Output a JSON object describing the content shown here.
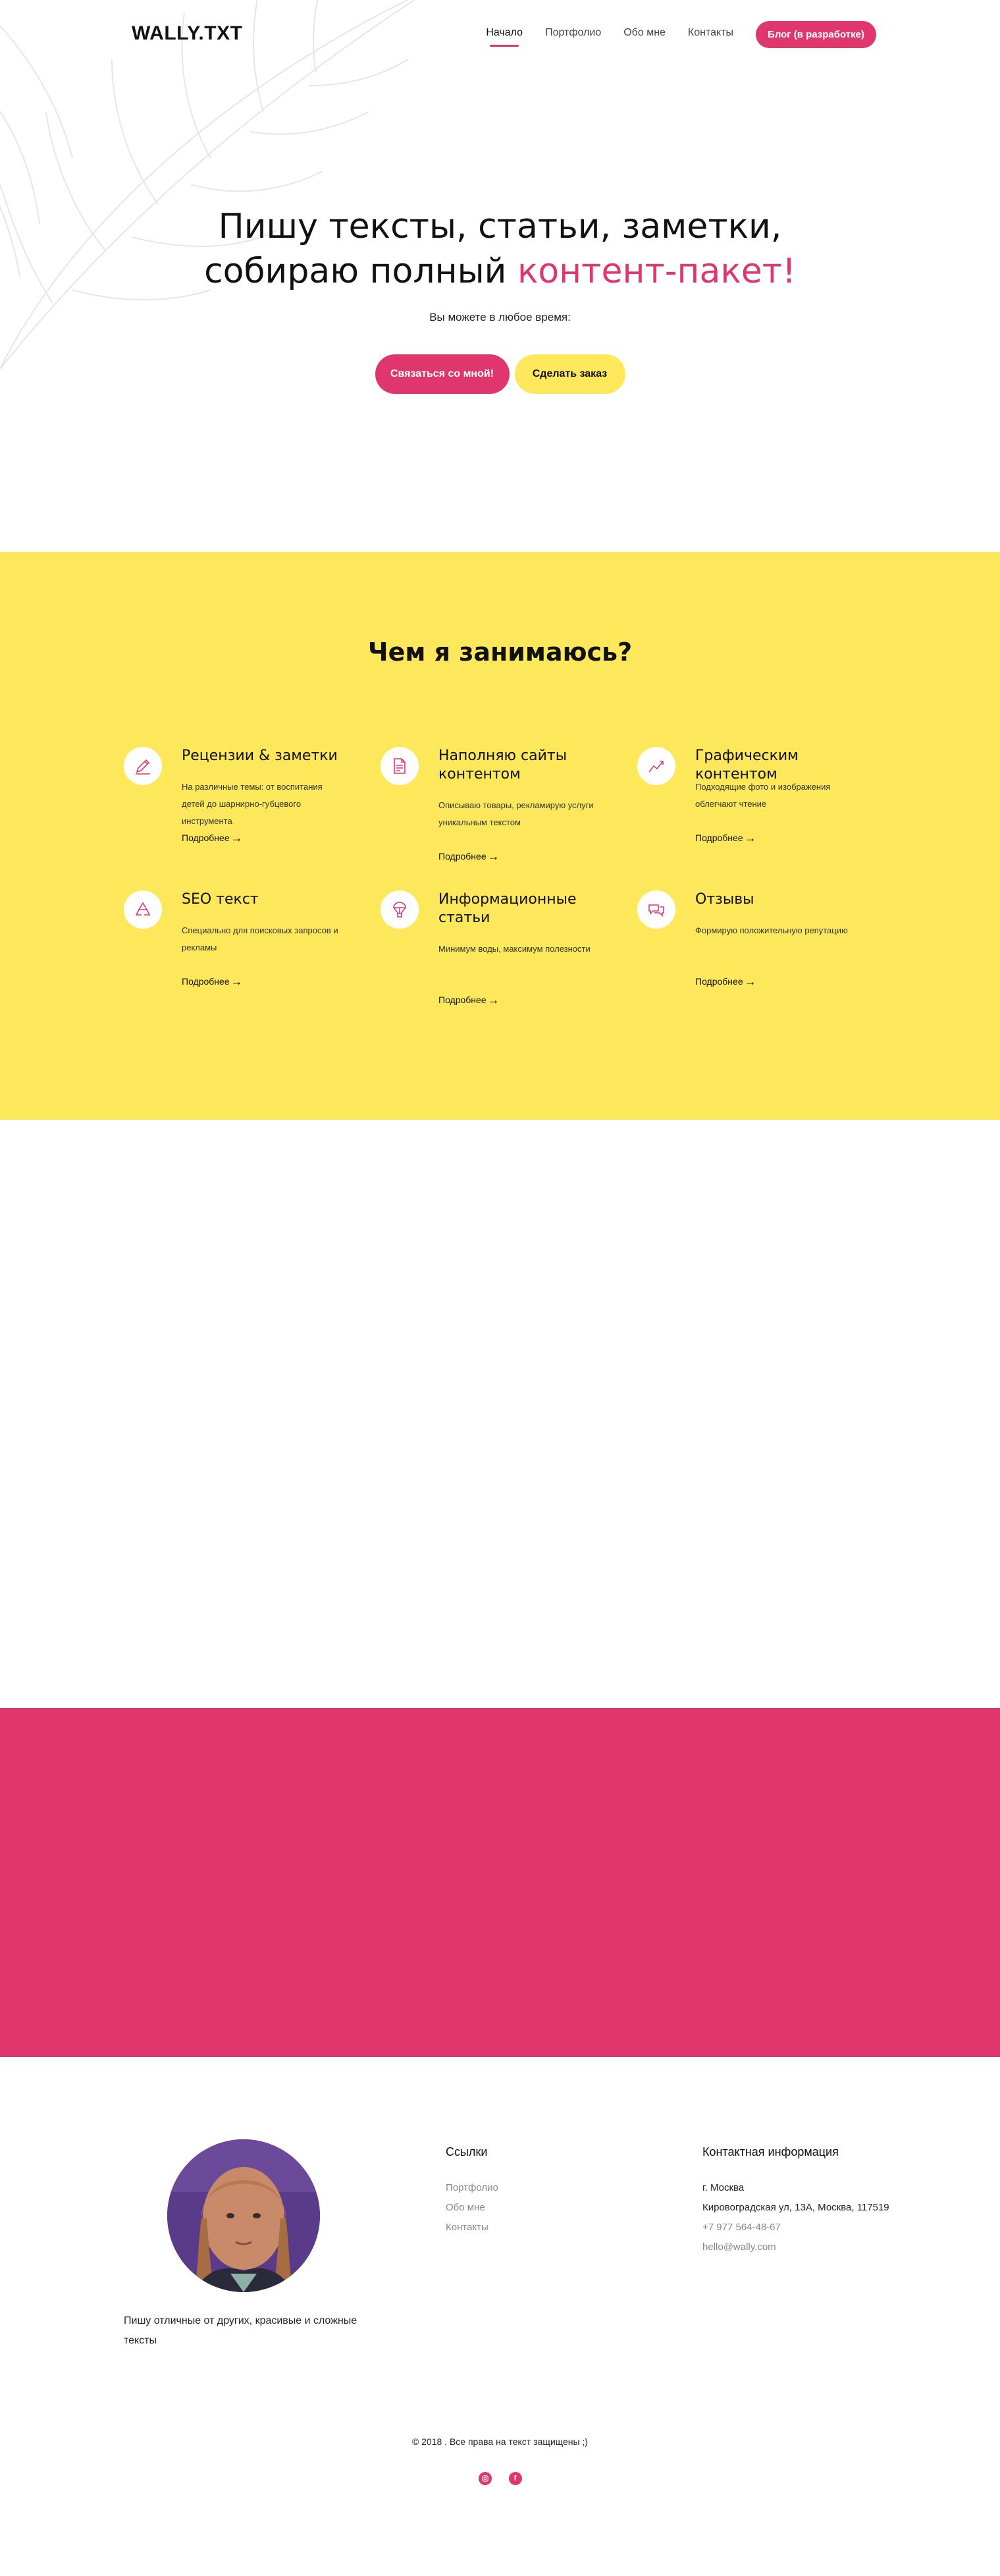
{
  "header": {
    "logo": "WALLY.TXT",
    "nav": [
      {
        "label": "Начало",
        "active": true
      },
      {
        "label": "Портфолио"
      },
      {
        "label": "Обо мне"
      },
      {
        "label": "Контакты"
      }
    ],
    "blog_button": "Блог (в разработке)"
  },
  "hero": {
    "title_line1": "Пишу тексты, статьи, заметки,",
    "title_line2_plain": "собираю полный ",
    "title_line2_accent": "контент-пакет!",
    "subtitle": "Вы можете в любое время:",
    "primary_button": "Связаться со мной!",
    "secondary_button": "Сделать заказ"
  },
  "services": {
    "title": "Чем я занимаюсь?",
    "more_label": "Подробнее",
    "items": [
      {
        "icon": "pencil-icon",
        "title": "Рецензии & заметки",
        "desc": "На различные темы: от воспитания детей до шарнирно-губцевого инструмента"
      },
      {
        "icon": "document-icon",
        "title": "Наполняю сайты контентом",
        "desc": "Описываю товары, рекламирую услуги уникальным текстом"
      },
      {
        "icon": "chart-line-icon",
        "title": "Графическим контентом",
        "desc": "Подходящие фото и изображения облегчают чтение"
      },
      {
        "icon": "recycle-icon",
        "title": "SEO текст",
        "desc": "Специально для поисковых запросов и рекламы"
      },
      {
        "icon": "balloon-icon",
        "title": "Информационные статьи",
        "desc": "Минимум воды, максимум полезности"
      },
      {
        "icon": "chat-bubbles-icon",
        "title": "Отзывы",
        "desc": "Формирую положительную репутацию"
      }
    ]
  },
  "footer": {
    "about": "Пишу отличные от других, красивые и сложные тексты",
    "links_title": "Ссылки",
    "links": [
      "Портфолио",
      "Обо мне",
      "Контакты"
    ],
    "contact_title": "Контактная информация",
    "city": "г. Москва",
    "address": "Кировоградская ул, 13А, Москва, 117519",
    "phone": "+7 977 564-48-67",
    "email": "hello@wally.com",
    "copyright": "© 2018 . Все права на текст защищены ;)",
    "socials": [
      "instagram-icon",
      "facebook-icon"
    ]
  },
  "colors": {
    "accent_pink": "#e0366e",
    "accent_yellow": "#fde85c"
  }
}
